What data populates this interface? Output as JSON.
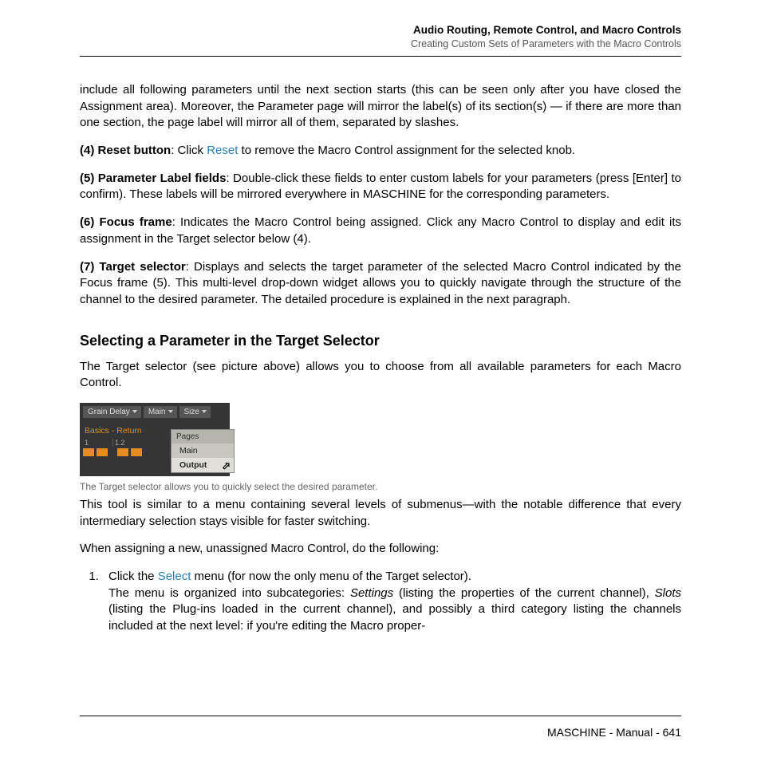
{
  "header": {
    "line1": "Audio Routing, Remote Control, and Macro Controls",
    "line2": "Creating Custom Sets of Parameters with the Macro Controls"
  },
  "para_intro": "include all following parameters until the next section starts (this can be seen only after you have closed the Assignment area). Moreover, the Parameter page will mirror the label(s) of its section(s) — if there are more than one section, the page label will mirror all of them, separated by slashes.",
  "item4": {
    "num": "(4)",
    "label": "Reset button",
    "pre": ": Click ",
    "link": "Reset",
    "post": " to remove the Macro Control assignment for the selected knob."
  },
  "item5": {
    "num": "(5)",
    "label": "Parameter Label fields",
    "text": ": Double-click these fields to enter custom labels for your parameters (press [Enter] to confirm). These labels will be mirrored everywhere in MASCHINE for the corresponding parameters."
  },
  "item6": {
    "num": "(6)",
    "label": "Focus frame",
    "text": ": Indicates the Macro Control being assigned. Click any Macro Control to display and edit its assignment in the Target selector below (4)."
  },
  "item7": {
    "num": "(7)",
    "label": "Target selector",
    "text": ": Displays and selects the target parameter of the selected Macro Control indicated by the Focus frame (5). This multi-level drop-down widget allows you to quickly navigate through the structure of the channel to the desired parameter. The detailed procedure is explained in the next paragraph."
  },
  "section_heading": "Selecting a Parameter in the Target Selector",
  "section_intro": "The Target selector (see picture above) allows you to choose from all available parameters for each Macro Control.",
  "figure": {
    "crumbs": [
      "Grain Delay",
      "Main",
      "Size"
    ],
    "basics_label": "Basics - Return",
    "cell_labels": [
      "1",
      "1.2"
    ],
    "dropdown_header": "Pages",
    "dropdown_items": [
      "Main",
      "Output"
    ]
  },
  "figcaption": "The Target selector allows you to quickly select the desired parameter.",
  "para_tool": "This tool is similar to a menu containing several levels of submenus—with the notable difference that every intermediary selection stays visible for faster switching.",
  "para_assign": "When assigning a new, unassigned Macro Control, do the following:",
  "step1": {
    "pre": "Click the ",
    "link": "Select",
    "mid": " menu (for now the only menu of the Target selector).",
    "body_pre": "The menu is organized into subcategories: ",
    "settings": "Settings",
    "body_mid1": " (listing the properties of the current channel), ",
    "slots": "Slots",
    "body_mid2": " (listing the Plug-ins loaded in the current channel), and possibly a third category listing the channels included at the next level: if you're editing the Macro proper-"
  },
  "footer": "MASCHINE - Manual - 641"
}
